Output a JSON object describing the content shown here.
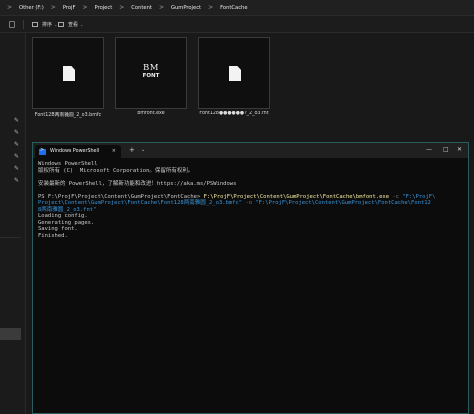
{
  "breadcrumb": {
    "items": [
      "Other (F:)",
      "ProjF",
      "Project",
      "Content",
      "GumProject",
      "FontCache"
    ],
    "separator": ">"
  },
  "toolbar": {
    "sort_label": "排序",
    "view_label": "查看",
    "dropdown_glyph": "⌄"
  },
  "files": [
    {
      "name": "Font12B两南雅圆_2_o3.bmfc",
      "icon": "file-icon"
    },
    {
      "name": "bmfont.exe",
      "icon": "bmfont-icon",
      "icon_line1": "BM",
      "icon_line2": "FONT"
    },
    {
      "name": "Font128●●●●●●?_2_o3.fnt",
      "icon": "file-icon"
    }
  ],
  "powershell": {
    "tab_title": "Windows PowerShell",
    "tab_close": "×",
    "new_tab": "+",
    "tab_dropdown": "⌄",
    "controls": {
      "minimize": "—",
      "maximize": "□",
      "close": "✕"
    },
    "lines": {
      "l1": "Windows PowerShell",
      "l2": "版权所有 (C)  Microsoft Corporation。保留所有权利。",
      "l3": "安装最新的 PowerShell，了解新功能和改进！https://aka.ms/PSWindows",
      "prompt1": "PS F:\\ProjF\\Project\\Content\\GumProject\\FontCache> ",
      "cmd_exe": "F:\\ProjF\\Project\\Content\\GumProject\\FontCache\\bmfont.exe",
      "cmd_flag_c": "-c",
      "cmd_arg1_start": "\"F:\\ProjF\\",
      "cmd_arg1_rest": "Project\\Content\\GumProject\\FontCache\\Font128两南雅圆_2_o3.bmfc\"",
      "cmd_flag_o": "-o",
      "cmd_arg2_start": "\"F:\\ProjF\\Project\\Content\\GumProject\\FontCache\\Font12",
      "cmd_arg2_rest": "8两南雅圆_2_o3.fnt\"",
      "out1": "Loading config.",
      "out2": "Generating pages.",
      "out3": "Saving font.",
      "out4": "Finished."
    }
  },
  "colors": {
    "command": "#f9f1a5",
    "string_arg": "#3a96dd",
    "flag": "#7a7a7a",
    "window_border": "#2a5d5d",
    "ps_icon": "#1f6feb"
  }
}
